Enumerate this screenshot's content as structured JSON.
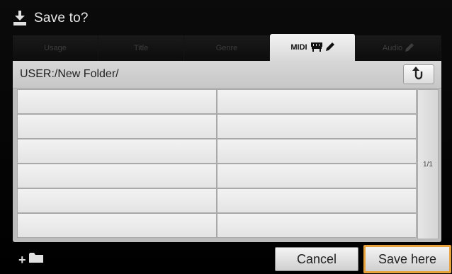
{
  "header": {
    "title": "Save to?",
    "icon": "save-download-icon"
  },
  "tabs": [
    {
      "label": "Usage",
      "active": false
    },
    {
      "label": "Title",
      "active": false
    },
    {
      "label": "Genre",
      "active": false
    },
    {
      "label": "MIDI",
      "active": true,
      "icons": [
        "keyboard-icon",
        "pencil-icon"
      ]
    },
    {
      "label": "Audio",
      "active": false,
      "icons": [
        "pencil-icon"
      ]
    }
  ],
  "path": {
    "text": "USER:/New Folder/",
    "up_icon": "back-up-arrow-icon"
  },
  "files": {
    "columns": 2,
    "rows": 6,
    "items": []
  },
  "pager": {
    "text": "1/1"
  },
  "footer": {
    "new_folder_icon": "new-folder-icon",
    "cancel_label": "Cancel",
    "save_label": "Save here"
  },
  "colors": {
    "highlight": "#e8a23c",
    "panel": "#bdbdbd",
    "background": "#000000"
  }
}
